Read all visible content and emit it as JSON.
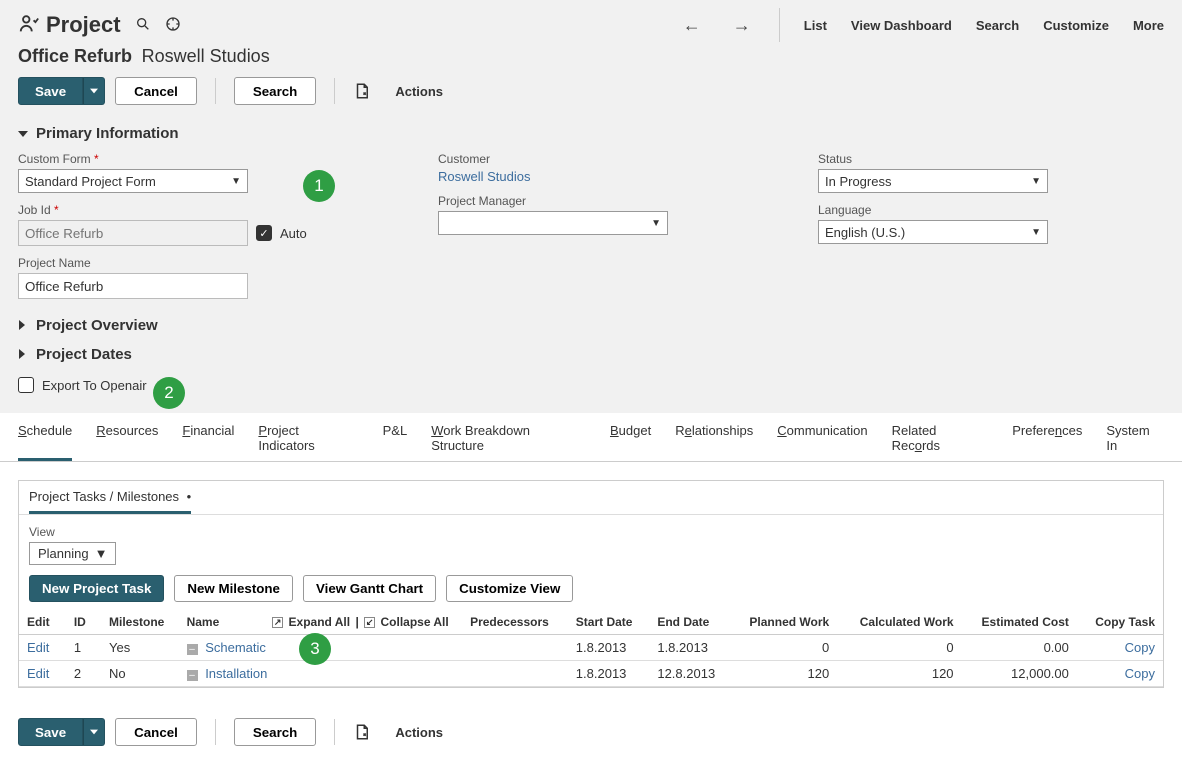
{
  "header": {
    "record_type": "Project",
    "project_name": "Office Refurb",
    "customer_name": "Roswell Studios",
    "nav": {
      "list": "List",
      "view_dashboard": "View Dashboard",
      "search": "Search",
      "customize": "Customize",
      "more": "More"
    }
  },
  "toolbar": {
    "save": "Save",
    "cancel": "Cancel",
    "search": "Search",
    "actions": "Actions"
  },
  "sections": {
    "primary_info": "Primary Information",
    "project_overview": "Project Overview",
    "project_dates": "Project Dates"
  },
  "fields": {
    "custom_form": {
      "label": "Custom Form",
      "value": "Standard Project Form"
    },
    "job_id": {
      "label": "Job Id",
      "placeholder": "Office Refurb",
      "auto_label": "Auto",
      "auto_checked": true
    },
    "project_name": {
      "label": "Project Name",
      "value": "Office Refurb"
    },
    "customer": {
      "label": "Customer",
      "value": "Roswell Studios"
    },
    "project_manager": {
      "label": "Project Manager",
      "value": ""
    },
    "status": {
      "label": "Status",
      "value": "In Progress"
    },
    "language": {
      "label": "Language",
      "value": "English (U.S.)"
    },
    "export_to_openair": {
      "label": "Export To Openair",
      "checked": false
    }
  },
  "tabs": [
    {
      "label": "Schedule",
      "underlined": "S",
      "rest": "chedule",
      "active": true
    },
    {
      "label": "Resources",
      "underlined": "R",
      "rest": "esources"
    },
    {
      "label": "Financial",
      "underlined": "F",
      "rest": "inancial"
    },
    {
      "label": "Project Indicators",
      "underlined": "P",
      "rest": "roject Indicators"
    },
    {
      "label": "P&L",
      "underlined": "",
      "rest": "P&L"
    },
    {
      "label": "Work Breakdown Structure",
      "underlined": "W",
      "rest": "ork Breakdown Structure"
    },
    {
      "label": "Budget",
      "underlined": "B",
      "rest": "udget"
    },
    {
      "label": "Relationships",
      "underlined": "R",
      "rest": "elationships"
    },
    {
      "label": "Communication",
      "underlined": "C",
      "rest": "ommunication"
    },
    {
      "label": "Related Records",
      "underlined": "",
      "rest": "Related Records"
    },
    {
      "label": "Preferences",
      "underlined": "",
      "rest": "Preferences",
      "u2": "n",
      "pre": "Prefere",
      "post": "ces"
    },
    {
      "label": "System Information",
      "underlined": "",
      "rest": "System In"
    }
  ],
  "subtab": {
    "title": "Project Tasks / Milestones",
    "bullet": "•"
  },
  "schedule": {
    "view_label": "View",
    "view_value": "Planning",
    "buttons": {
      "new_task": "New Project Task",
      "new_milestone": "New Milestone",
      "view_gantt": "View Gantt Chart",
      "customize_view": "Customize View"
    },
    "cols": {
      "edit": "Edit",
      "id": "ID",
      "milestone": "Milestone",
      "name": "Name",
      "expand_all": "Expand All",
      "collapse_all": "Collapse All",
      "predecessors": "Predecessors",
      "start": "Start Date",
      "end": "End Date",
      "planned": "Planned Work",
      "calculated": "Calculated Work",
      "estimated": "Estimated Cost",
      "copy": "Copy Task",
      "divider": "|"
    },
    "rows": [
      {
        "edit": "Edit",
        "id": "1",
        "milestone": "Yes",
        "name": "Schematic",
        "pred": "",
        "start": "1.8.2013",
        "end": "1.8.2013",
        "planned": "0",
        "calc": "0",
        "est": "0.00",
        "copy": "Copy"
      },
      {
        "edit": "Edit",
        "id": "2",
        "milestone": "No",
        "name": "Installation",
        "pred": "",
        "start": "1.8.2013",
        "end": "12.8.2013",
        "planned": "120",
        "calc": "120",
        "est": "12,000.00",
        "copy": "Copy"
      }
    ]
  },
  "callouts": {
    "one": "1",
    "two": "2",
    "three": "3"
  },
  "colors": {
    "primary": "#2a5f6f",
    "callout_green": "#2f9e44",
    "link_blue": "#3c6d9e"
  }
}
